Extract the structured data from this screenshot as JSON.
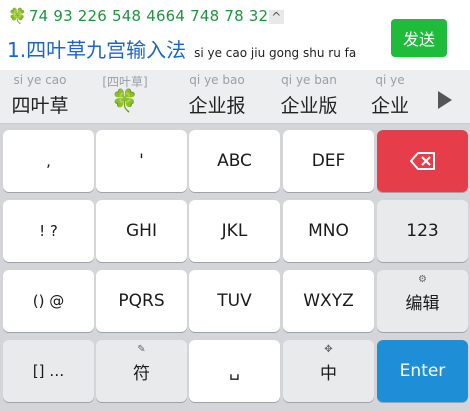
{
  "composition": {
    "lead_icon": "🍀",
    "digits": "74 93 226 548 4664 748 78 32",
    "caret_glyph": "^",
    "candidate_index": "1.",
    "candidate_text": "四叶草九宫输入法",
    "candidate_pinyin": "si ye cao jiu gong shu ru fa",
    "send_label": "发送"
  },
  "candidates": [
    {
      "pinyin": "si ye cao",
      "word": "四叶草"
    },
    {
      "pinyin": "[四叶草]",
      "word": "🍀"
    },
    {
      "pinyin": "qi ye bao",
      "word": "企业报"
    },
    {
      "pinyin": "qi ye ban",
      "word": "企业版"
    },
    {
      "pinyin": "qi ye",
      "word": "企业"
    }
  ],
  "keys": {
    "r1": [
      {
        "label": ", "
      },
      {
        "label": "'"
      },
      {
        "label": "ABC"
      },
      {
        "label": "DEF"
      },
      {
        "label": "⌫"
      }
    ],
    "r2": [
      {
        "label": "! ?"
      },
      {
        "label": "GHI"
      },
      {
        "label": "JKL"
      },
      {
        "label": "MNO"
      },
      {
        "label": "123"
      }
    ],
    "r3": [
      {
        "label": "() @"
      },
      {
        "label": "PQRS"
      },
      {
        "label": "TUV"
      },
      {
        "label": "WXYZ"
      },
      {
        "label": "编辑",
        "sup": "⚙"
      }
    ],
    "r4": [
      {
        "label": "[] …",
        "label2": "…"
      },
      {
        "label": "符",
        "sup": "✎"
      },
      {
        "label": "␣"
      },
      {
        "label": "中",
        "sup": "✥"
      },
      {
        "label": "Enter"
      }
    ]
  },
  "colors": {
    "send": "#1ebc3a",
    "delete": "#e53e4a",
    "enter": "#1e8fd6",
    "candidate_blue": "#1a66c8",
    "digits_green": "#1e9440"
  }
}
